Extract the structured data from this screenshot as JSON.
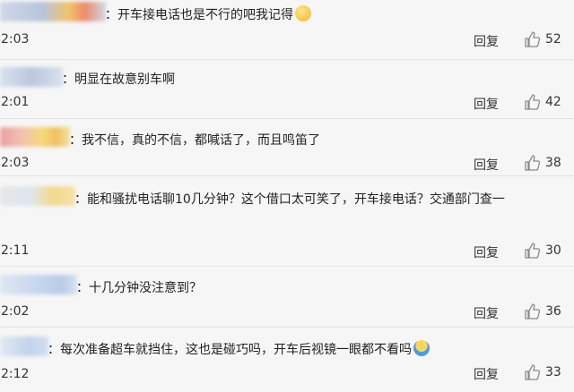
{
  "comments": [
    {
      "text": "：开车接电话也是不行的吧我记得",
      "time": "2:03",
      "reply": "回复",
      "likes": "52",
      "emoji": "smile-emoji"
    },
    {
      "text": "：明显在故意别车啊",
      "time": "2:01",
      "reply": "回复",
      "likes": "42"
    },
    {
      "text": "：我不信，真的不信，都喊话了，而且鸣笛了",
      "time": "2:03",
      "reply": "回复",
      "likes": "38"
    },
    {
      "text": "：能和骚扰电话聊10几分钟？这个借口太可笑了，开车接电话？交通部门查一",
      "time": "2:11",
      "reply": "回复",
      "likes": "30"
    },
    {
      "text": "：十几分钟没注意到？",
      "time": "2:02",
      "reply": "回复",
      "likes": "36"
    },
    {
      "text": "：每次准备超车就挡住，这也是碰巧吗，开车后视镜一眼都不看吗",
      "time": "2:12",
      "reply": "回复",
      "likes": "33",
      "emoji": "shrug-emoji"
    }
  ],
  "colors": {
    "accent_blue": "#c9d8f2",
    "accent_yellow": "#f6d97a",
    "accent_red": "#ee8a7a",
    "icon": "#8a8a8a"
  }
}
